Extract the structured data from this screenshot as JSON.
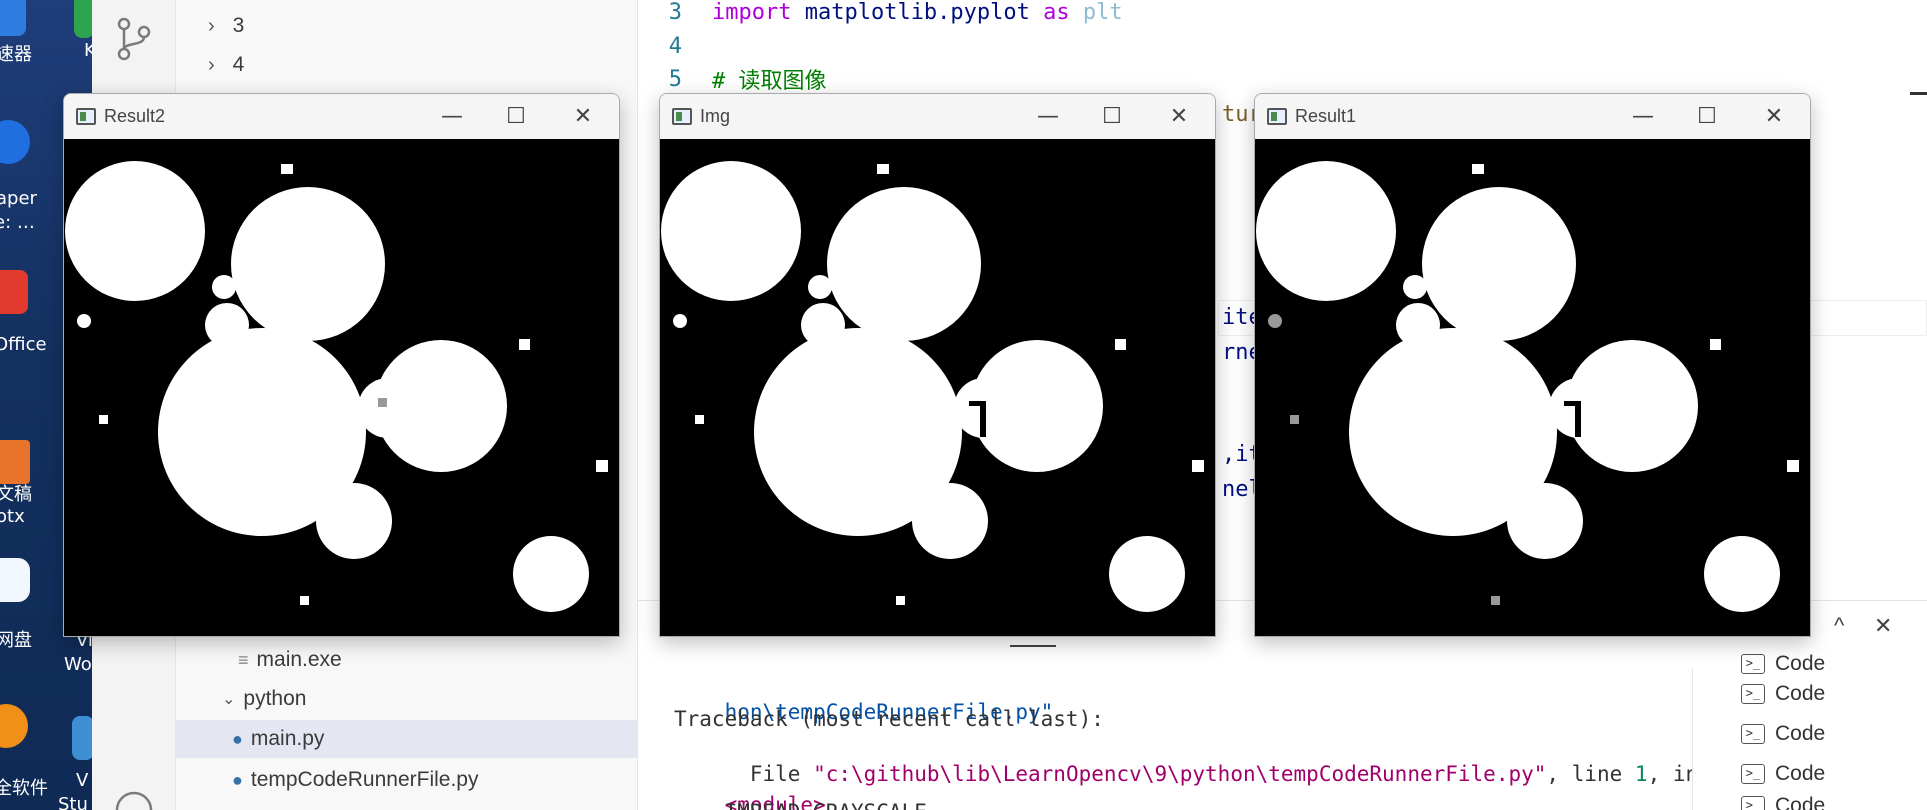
{
  "desktop": {
    "labels": [
      "速器",
      "aper",
      "e: …",
      "Office",
      "文稿",
      "otx",
      "网盘",
      "全软件",
      "K",
      "Vi",
      "Wo",
      "V",
      "Stu"
    ]
  },
  "explorer": {
    "items": [
      {
        "label": "3",
        "kind": "folder-collapsed"
      },
      {
        "label": "4",
        "kind": "folder-collapsed"
      },
      {
        "label": "main.exe",
        "kind": "file"
      },
      {
        "label": "python",
        "kind": "folder-expanded"
      },
      {
        "label": "main.py",
        "kind": "python-file",
        "selected": true
      },
      {
        "label": "tempCodeRunnerFile.py",
        "kind": "python-file"
      }
    ]
  },
  "editor": {
    "lines": [
      {
        "num": "3",
        "kw": "import",
        "mod": " matplotlib.pyplot ",
        "kw2": "as",
        "rest": " plt"
      },
      {
        "num": "4"
      },
      {
        "num": "5",
        "comment": "# 读取图像"
      }
    ],
    "fragments": [
      "tur",
      "ite",
      "rne",
      ",it",
      "nel"
    ]
  },
  "terminal": {
    "lines": [
      {
        "str": "hon\\tempCodeRunnerFile.py\""
      },
      {
        "text": "Traceback (most recent call last):"
      },
      {
        "pre": "  File ",
        "path": "\"c:\\github\\lib\\LearnOpencv\\9\\python\\tempCodeRunnerFile.py\"",
        "mid": ", line ",
        "num": "1",
        "post": ", in"
      },
      {
        "path": "<module>"
      },
      {
        "text": "    IMREAD_GRAYSCALE"
      }
    ],
    "list_items": [
      "Code",
      "Code",
      "Code",
      "Code",
      "Code"
    ]
  },
  "windows": [
    {
      "title": "Result2",
      "min": "—",
      "max": "☐",
      "close": "✕"
    },
    {
      "title": "Img",
      "min": "—",
      "max": "☐",
      "close": "✕"
    },
    {
      "title": "Result1",
      "min": "—",
      "max": "☐",
      "close": "✕"
    }
  ],
  "panel_controls": {
    "up": "^",
    "close": "✕"
  },
  "colors": {
    "desktop": "#1a3669",
    "selection": "#e4e6f1",
    "keyword": "#af00db",
    "comment": "#008000"
  }
}
